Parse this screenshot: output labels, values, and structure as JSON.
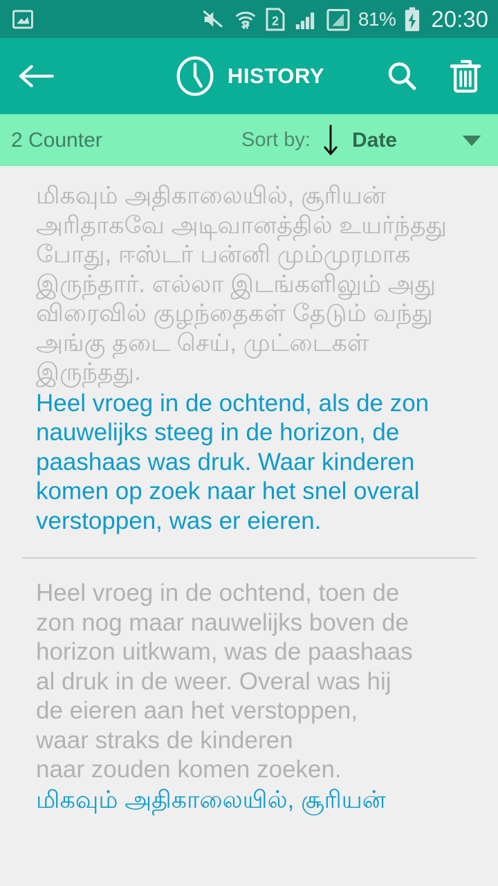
{
  "status_bar": {
    "icons": [
      "screenshot-image-icon",
      "mute-icon",
      "wifi-transfer-icon",
      "sim2-icon",
      "signal-bars-icon",
      "data-signal-icon",
      "charging-battery-icon"
    ],
    "sim_label": "2",
    "battery_percent": "81%",
    "time": "20:30",
    "background_color": "#0e8c7c"
  },
  "app_bar": {
    "back_icon": "back-arrow-icon",
    "clock_icon": "clock-icon",
    "title": "HISTORY",
    "search_icon": "search-icon",
    "delete_icon": "trash-icon",
    "background_color": "#0bae96"
  },
  "sort_bar": {
    "counter": "2 Counter",
    "sort_label": "Sort by:",
    "sort_direction_icon": "arrow-down-icon",
    "sort_value": "Date",
    "dropdown_icon": "caret-down-icon",
    "background_color": "#7ff0b8"
  },
  "history": {
    "entries": [
      {
        "source_text": "மிகவும் அதிகாலையில், சூரியன் அரிதாகவே அடிவானத்தில் உயர்ந்தது போது, ஈஸ்டர் பன்னி மும்முரமாக இருந்தார். எல்லா இடங்களிலும் அது விரைவில் குழந்தைகள் தேடும் வந்து அங்கு தடை செய், முட்டைகள் இருந்தது.",
        "target_text": "Heel vroeg in de ochtend, als de zon nauwelijks steeg in de horizon, de paashaas was druk. Waar kinderen komen op zoek naar het snel overal verstoppen, was er eieren.",
        "target_color": "#0e9bc9"
      },
      {
        "source_text_line1": "Heel vroeg in de ochtend, toen de",
        "source_text_line2": "zon nog maar nauwelijks boven de",
        "source_text_line3": "horizon uitkwam, was de paashaas",
        "source_text_line4": "al druk in de weer. Overal was hij",
        "source_text_line5": "de eieren aan het verstoppen,",
        "source_text_line6": "waar straks de kinderen",
        "source_text_line7": "naar zouden komen zoeken.",
        "target_text": "மிகவும் அதிகாலையில், சூரியன்",
        "target_color": "#0e9bc9"
      }
    ]
  }
}
